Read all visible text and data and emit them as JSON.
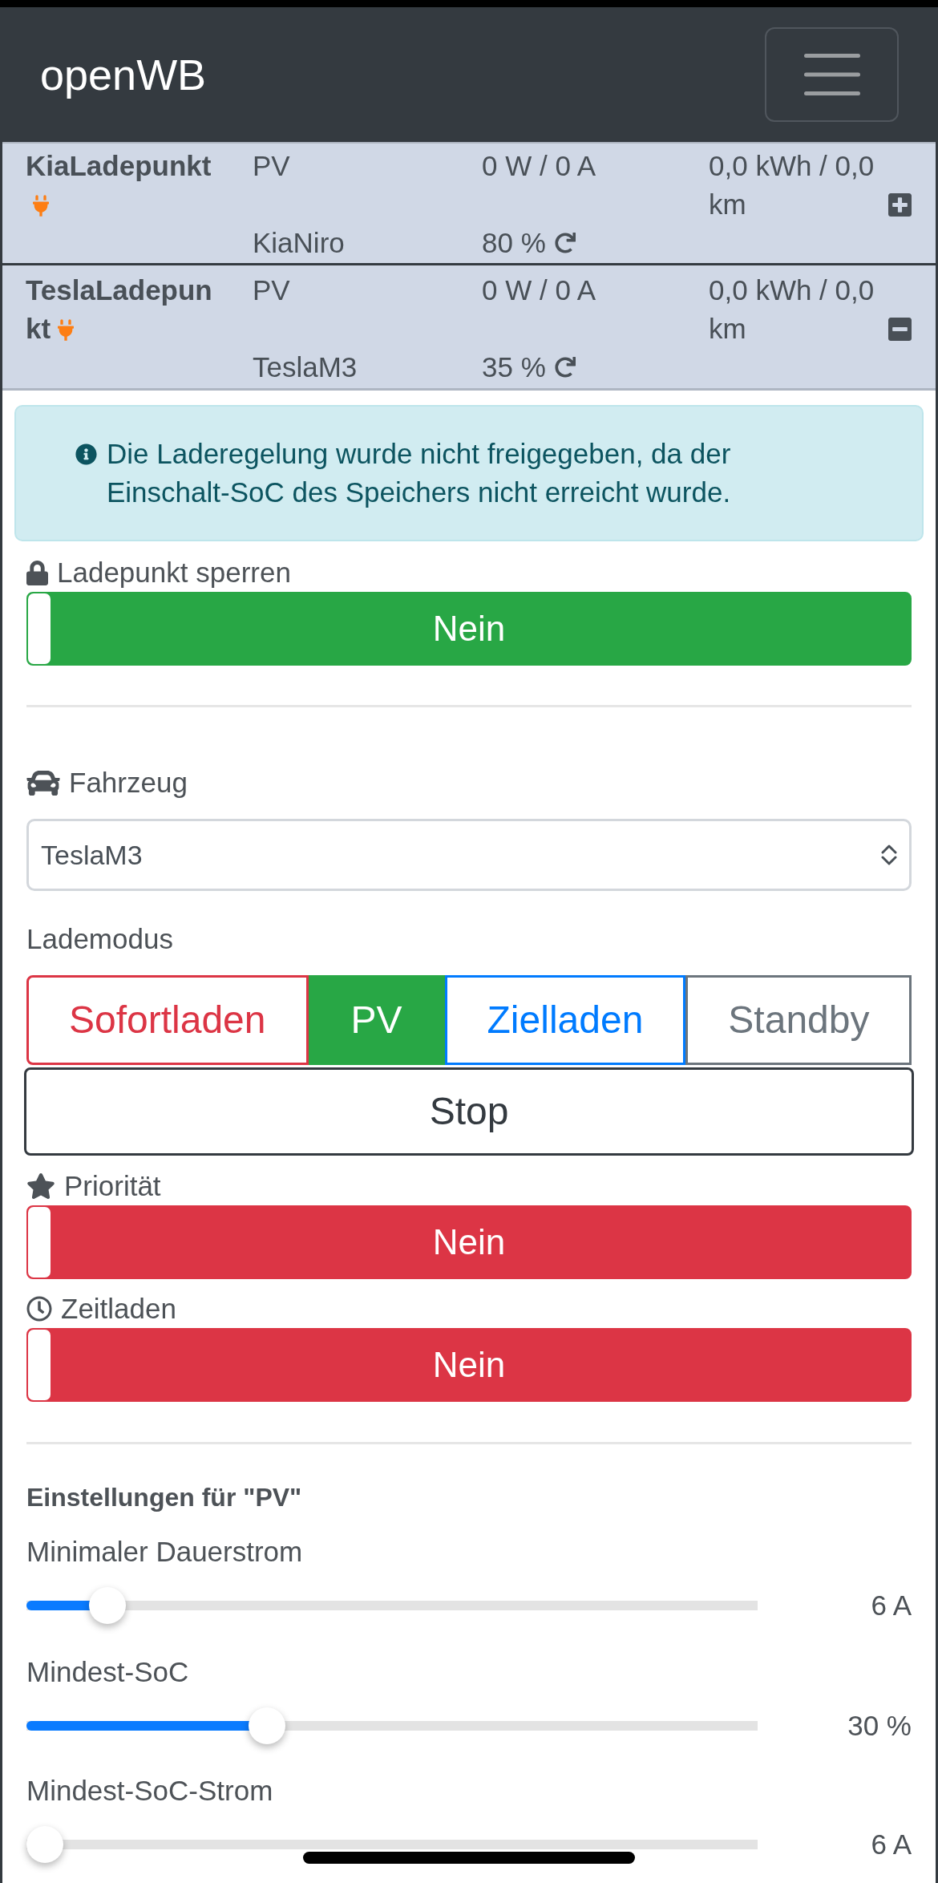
{
  "navbar": {
    "brand": "openWB"
  },
  "charge_points": [
    {
      "name": "KiaLadepunkt",
      "plugged": true,
      "mode": "PV",
      "power": "0 W / 0 A",
      "energy": "0,0 kWh / 0,0 km",
      "vehicle": "KiaNiro",
      "soc": "80 %",
      "expanded": false
    },
    {
      "name": "TeslaLadepunkt",
      "plugged": true,
      "mode": "PV",
      "power": "0 W / 0 A",
      "energy": "0,0 kWh / 0,0 km",
      "vehicle": "TeslaM3",
      "soc": "35 %",
      "expanded": true
    }
  ],
  "alert": {
    "text": "Die Laderegelung wurde nicht freigegeben, da der Einschalt-SoC des Speichers nicht erreicht wurde."
  },
  "lock_switch": {
    "label": "Ladepunkt sperren",
    "value": "Nein",
    "on": false,
    "color": "#28a745"
  },
  "vehicle": {
    "label": "Fahrzeug",
    "value": "TeslaM3"
  },
  "charge_mode": {
    "label": "Lademodus",
    "options": [
      {
        "label": "Sofortladen",
        "selected": false,
        "color": "#dc3545"
      },
      {
        "label": "PV",
        "selected": true,
        "color": "#28a745"
      },
      {
        "label": "Zielladen",
        "selected": false,
        "color": "#007bff"
      },
      {
        "label": "Standby",
        "selected": false,
        "color": "#6c757d"
      },
      {
        "label": "Stop",
        "selected": false,
        "color": "#343a40"
      }
    ]
  },
  "priority_switch": {
    "label": "Priorität",
    "value": "Nein",
    "on": false,
    "color": "#dc3545"
  },
  "timed_charging_switch": {
    "label": "Zeitladen",
    "value": "Nein",
    "on": false,
    "color": "#dc3545"
  },
  "settings": {
    "title": "Einstellungen für \"PV\"",
    "sliders": [
      {
        "label": "Minimaler Dauerstrom",
        "level": 0.09,
        "reading": "6 A"
      },
      {
        "label": "Mindest-SoC",
        "level": 0.32,
        "reading": "30 %"
      },
      {
        "label": "Mindest-SoC-Strom",
        "level": 0,
        "reading": "6 A"
      }
    ]
  }
}
